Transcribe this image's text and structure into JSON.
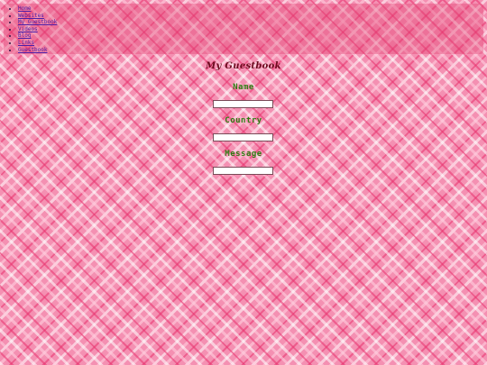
{
  "nav": {
    "items": [
      {
        "label": "Home"
      },
      {
        "label": "Websites"
      },
      {
        "label": "My Guestbook"
      },
      {
        "label": "Videos"
      },
      {
        "label": "Blog"
      },
      {
        "label": "Links"
      },
      {
        "label": "Guestbook"
      }
    ]
  },
  "guestbook": {
    "title": "My Guestbook",
    "fields": {
      "name": {
        "label": "Name",
        "value": ""
      },
      "country": {
        "label": "Country",
        "value": ""
      },
      "message": {
        "label": "Message",
        "value": ""
      }
    }
  },
  "colors": {
    "background": "#f490b2",
    "nav_panel": "#e24070",
    "link": "#4b1fa8",
    "title": "#6b0a1e",
    "label": "#2f7a12"
  }
}
